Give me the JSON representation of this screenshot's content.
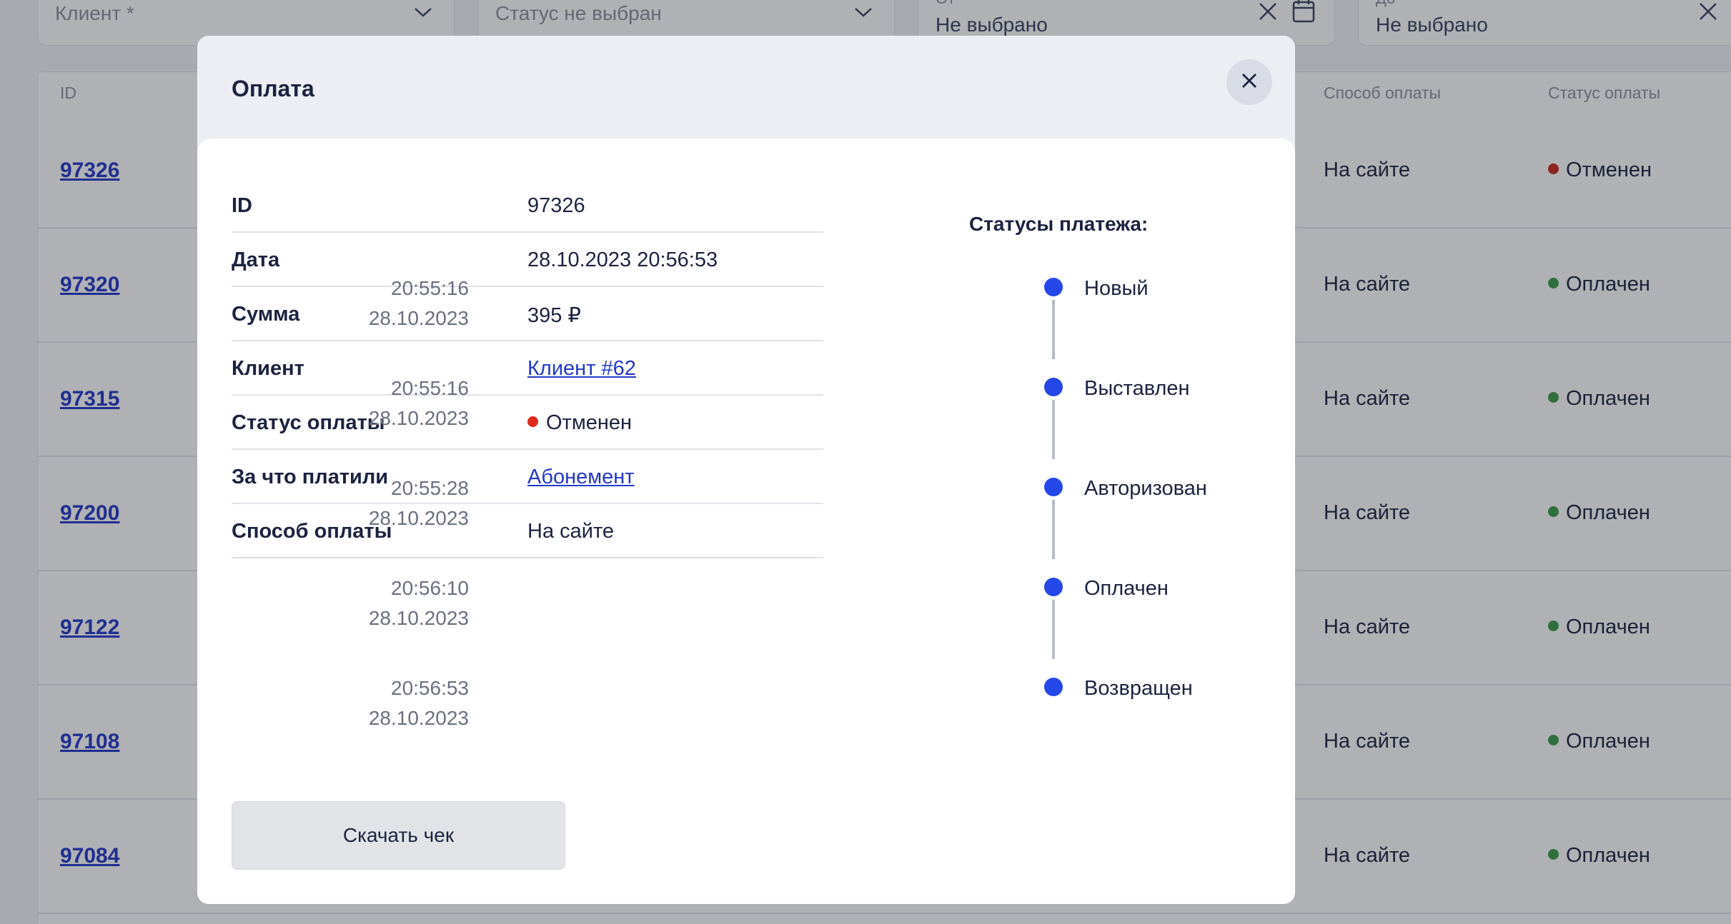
{
  "filters": {
    "client_placeholder": "Клиент *",
    "status_placeholder": "Статус не выбран",
    "from_label": "От",
    "from_value": "Не выбрано",
    "to_label": "До",
    "to_value": "Не выбрано"
  },
  "table": {
    "headers": {
      "id": "ID",
      "method": "Способ оплаты",
      "status": "Статус оплаты"
    },
    "rows": [
      {
        "id": "97326",
        "method": "На сайте",
        "status": "Отменен",
        "status_color": "#c9271d"
      },
      {
        "id": "97320",
        "method": "На сайте",
        "status": "Оплачен",
        "status_color": "#3a9a4a"
      },
      {
        "id": "97315",
        "method": "На сайте",
        "status": "Оплачен",
        "status_color": "#3a9a4a"
      },
      {
        "id": "97200",
        "method": "На сайте",
        "status": "Оплачен",
        "status_color": "#3a9a4a"
      },
      {
        "id": "97122",
        "method": "На сайте",
        "status": "Оплачен",
        "status_color": "#3a9a4a"
      },
      {
        "id": "97108",
        "method": "На сайте",
        "status": "Оплачен",
        "status_color": "#3a9a4a"
      },
      {
        "id": "97084",
        "method": "На сайте",
        "status": "Оплачен",
        "status_color": "#3a9a4a"
      }
    ]
  },
  "modal": {
    "title": "Оплата",
    "details": [
      {
        "label": "ID",
        "value": "97326"
      },
      {
        "label": "Дата",
        "value": "28.10.2023 20:56:53"
      },
      {
        "label": "Сумма",
        "value": "395 ₽"
      },
      {
        "label": "Клиент",
        "value": "Клиент #62"
      },
      {
        "label": "Статус оплаты",
        "value": "Отменен",
        "status_color": "#e0291c"
      },
      {
        "label": "За что платили",
        "value": "Абонемент"
      },
      {
        "label": "Способ оплаты",
        "value": "На сайте"
      }
    ],
    "timeline_title": "Статусы платежа:",
    "timeline": [
      {
        "time": "20:55:16",
        "date": "28.10.2023",
        "label": "Новый"
      },
      {
        "time": "20:55:16",
        "date": "28.10.2023",
        "label": "Выставлен"
      },
      {
        "time": "20:55:28",
        "date": "28.10.2023",
        "label": "Авторизован"
      },
      {
        "time": "20:56:10",
        "date": "28.10.2023",
        "label": "Оплачен"
      },
      {
        "time": "20:56:53",
        "date": "28.10.2023",
        "label": "Возвращен"
      }
    ],
    "download_label": "Скачать чек"
  },
  "colors": {
    "accent": "#2447e8",
    "link": "#2338c9",
    "cancelled": "#e0291c",
    "paid": "#3a9a4a"
  }
}
